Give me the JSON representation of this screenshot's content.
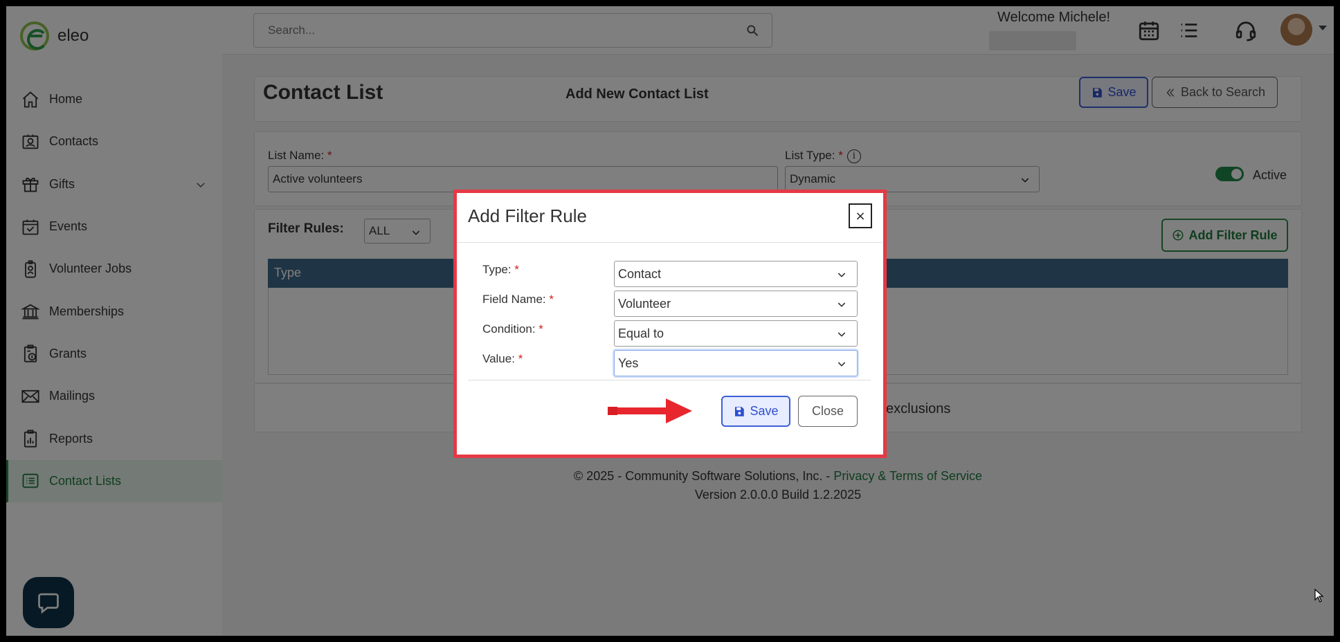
{
  "app": {
    "logo_text": "eleo"
  },
  "sidebar": {
    "items": [
      {
        "label": "Home",
        "icon": "home-icon"
      },
      {
        "label": "Contacts",
        "icon": "contact-card-icon"
      },
      {
        "label": "Gifts",
        "icon": "gift-icon",
        "expandable": true
      },
      {
        "label": "Events",
        "icon": "calendar-check-icon"
      },
      {
        "label": "Volunteer Jobs",
        "icon": "badge-icon"
      },
      {
        "label": "Memberships",
        "icon": "institution-icon"
      },
      {
        "label": "Grants",
        "icon": "grant-clipboard-icon"
      },
      {
        "label": "Mailings",
        "icon": "envelope-icon"
      },
      {
        "label": "Reports",
        "icon": "report-clipboard-icon"
      },
      {
        "label": "Contact Lists",
        "icon": "list-icon",
        "active": true
      }
    ]
  },
  "header": {
    "search_placeholder": "Search...",
    "welcome": "Welcome Michele!"
  },
  "page": {
    "title": "Contact List",
    "subtitle": "Add New Contact List",
    "save_label": "Save",
    "back_label": "Back to Search",
    "list_name_label": "List Name:",
    "list_name_value": "Active volunteers",
    "list_type_label": "List Type:",
    "list_type_value": "Dynamic",
    "active_label": "Active",
    "active_on": true,
    "filter_rules_label": "Filter Rules:",
    "filter_mode": "ALL",
    "add_filter_label": "Add Filter Rule",
    "grid_col_type": "Type",
    "exclusions_text": "exclusions"
  },
  "footer": {
    "copyright": "© 2025 - Community Software Solutions, Inc. - ",
    "link": "Privacy & Terms of Service",
    "version": "Version 2.0.0.0 Build 1.2.2025"
  },
  "modal": {
    "title": "Add Filter Rule",
    "close_x": "×",
    "fields": [
      {
        "label": "Type:",
        "value": "Contact"
      },
      {
        "label": "Field Name:",
        "value": "Volunteer"
      },
      {
        "label": "Condition:",
        "value": "Equal to"
      },
      {
        "label": "Value:",
        "value": "Yes"
      }
    ],
    "required_mark": "*",
    "save_label": "Save",
    "close_label": "Close"
  },
  "colors": {
    "brand_green": "#1f7a3c",
    "primary_blue": "#2f4fd0",
    "grid_header": "#3f6a8a",
    "highlight_red": "#e53945"
  }
}
